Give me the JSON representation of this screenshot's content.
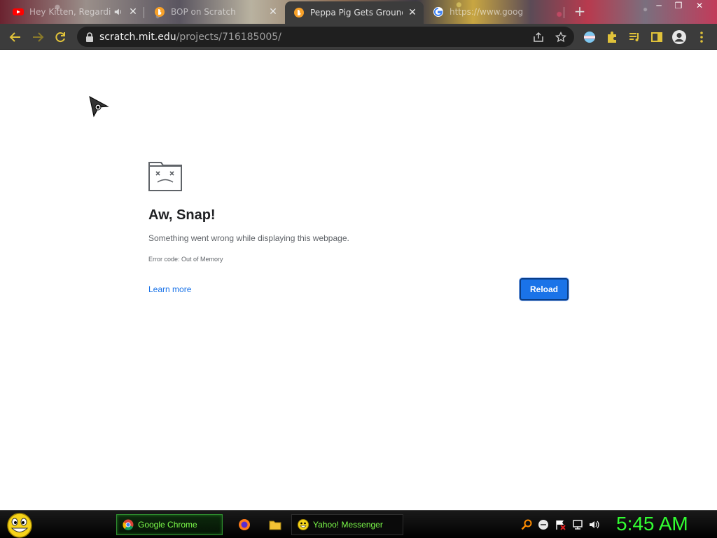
{
  "browser": {
    "tabs": [
      {
        "title": "Hey Kitten, Regardi",
        "favicon": "youtube-icon",
        "audio": true,
        "active": false
      },
      {
        "title": "BOP on Scratch",
        "favicon": "scratch-icon",
        "active": false
      },
      {
        "title": "Peppa Pig Gets Grounde",
        "favicon": "scratch-icon",
        "active": true
      },
      {
        "title": "https://www.goog",
        "favicon": "google-icon",
        "active": false
      }
    ],
    "new_tab_glyph": "+",
    "window_controls": {
      "minimize": "─",
      "restore": "❐",
      "close": "✕"
    },
    "address": {
      "host": "scratch.mit.edu",
      "path": "/projects/716185005/",
      "secure_icon": "lock-icon"
    },
    "toolbar_icons": [
      "back-icon",
      "forward-icon",
      "reload-icon",
      "share-icon",
      "bookmark-star-icon",
      "extension-profile-icon",
      "extensions-puzzle-icon",
      "media-queue-icon",
      "side-panel-icon",
      "account-icon",
      "more-menu-icon"
    ]
  },
  "page": {
    "icon": "sad-tab-icon",
    "heading": "Aw, Snap!",
    "message": "Something went wrong while displaying this webpage.",
    "error_code": "Error code: Out of Memory",
    "learn_more": "Learn more",
    "reload": "Reload",
    "colors": {
      "accent": "#1a73e8",
      "text": "#202124",
      "secondary": "#5f6368"
    }
  },
  "taskbar": {
    "items": [
      {
        "label": "Google Chrome",
        "icon": "chrome-icon",
        "active": true
      },
      {
        "label": "Yahoo! Messenger",
        "icon": "yahoo-messenger-icon",
        "active": false
      }
    ],
    "quick_launch": [
      "firefox-icon",
      "folder-icon"
    ],
    "tray_icons": [
      "search-icon",
      "messenger-status-icon",
      "flag-icon",
      "network-icon",
      "volume-icon"
    ],
    "clock": "5:45 AM",
    "colors": {
      "text": "#32ff32"
    }
  }
}
